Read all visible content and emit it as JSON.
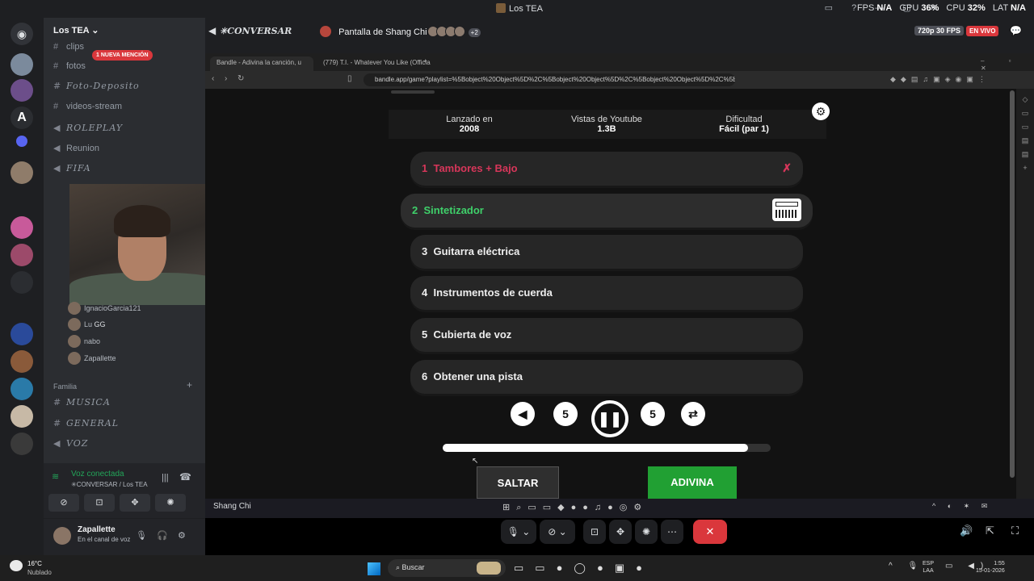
{
  "window": {
    "title": "Los TEA"
  },
  "perf": {
    "fps_label": "FPS",
    "fps": "N/A",
    "gpu_label": "GPU",
    "gpu": "36%",
    "cpu_label": "CPU",
    "cpu": "32%",
    "lat_label": "LAT",
    "lat": "N/A"
  },
  "server": {
    "name": "Los TEA"
  },
  "mention_badge": "1 NUEVA MENCIÓN",
  "channels": [
    {
      "name": "clips",
      "type": "text"
    },
    {
      "name": "fotos",
      "type": "text"
    },
    {
      "name": "Foto-Deposito",
      "type": "text"
    },
    {
      "name": "videos-stream",
      "type": "text"
    },
    {
      "name": "ROLEPLAY",
      "type": "voice"
    },
    {
      "name": "Reunion",
      "type": "voice"
    },
    {
      "name": "FIFA",
      "type": "voice"
    }
  ],
  "voice_users": [
    {
      "name": "IgnacioGarcia121"
    },
    {
      "name": "Lu",
      "tag": "GG"
    },
    {
      "name": "nabo"
    },
    {
      "name": "Zapallette"
    }
  ],
  "family": {
    "header": "Familia",
    "channels": [
      "MUSICA",
      "GENERAL",
      "VOZ"
    ]
  },
  "voice_panel": {
    "status": "Voz conectada",
    "sub": "✳CONVERSAR / Los TEA"
  },
  "user": {
    "name": "Zapallette",
    "status": "En el canal de voz"
  },
  "stage_header": {
    "channel": "✳CONVERSAR",
    "screen": "Pantalla de Shang Chi",
    "extra": "+2",
    "fps_badge": "720p 30 FPS",
    "live": "EN VIVO"
  },
  "browser": {
    "tabs": [
      "Bandle - Adivina la canción, u",
      "(779) T.I. - Whatever You Like (Officia"
    ],
    "url": "bandle.app/game?playlist=%5Bobject%20Object%5D%2C%5Bobject%20Object%5D%2C%5Bobject%20Object%5D%2C%5Bobject%5..."
  },
  "song_info": [
    {
      "label": "Lanzado en",
      "value": "2008"
    },
    {
      "label": "Vistas de Youtube",
      "value": "1.3B"
    },
    {
      "label": "Dificultad",
      "value": "Fácil (par 1)"
    }
  ],
  "stages": [
    {
      "num": "1",
      "label": "Tambores + Bajo",
      "state": "fail"
    },
    {
      "num": "2",
      "label": "Sintetizador",
      "state": "active"
    },
    {
      "num": "3",
      "label": "Guitarra eléctrica",
      "state": "locked"
    },
    {
      "num": "4",
      "label": "Instrumentos de cuerda",
      "state": "locked"
    },
    {
      "num": "5",
      "label": "Cubierta de voz",
      "state": "locked"
    },
    {
      "num": "6",
      "label": "Obtener una pista",
      "state": "locked"
    }
  ],
  "controls": {
    "rewind": "5",
    "forward": "5"
  },
  "progress": 0.93,
  "buttons": {
    "skip": "SALTAR",
    "guess": "ADIVINA"
  },
  "inner_taskbar": {
    "name": "Shang Chi"
  },
  "weather": {
    "temp": "16°C",
    "desc": "Nublado"
  },
  "taskbar": {
    "search": "Buscar",
    "lang1": "ESP",
    "lang2": "LAA",
    "time": "1:55",
    "date": "15-01-2026"
  }
}
